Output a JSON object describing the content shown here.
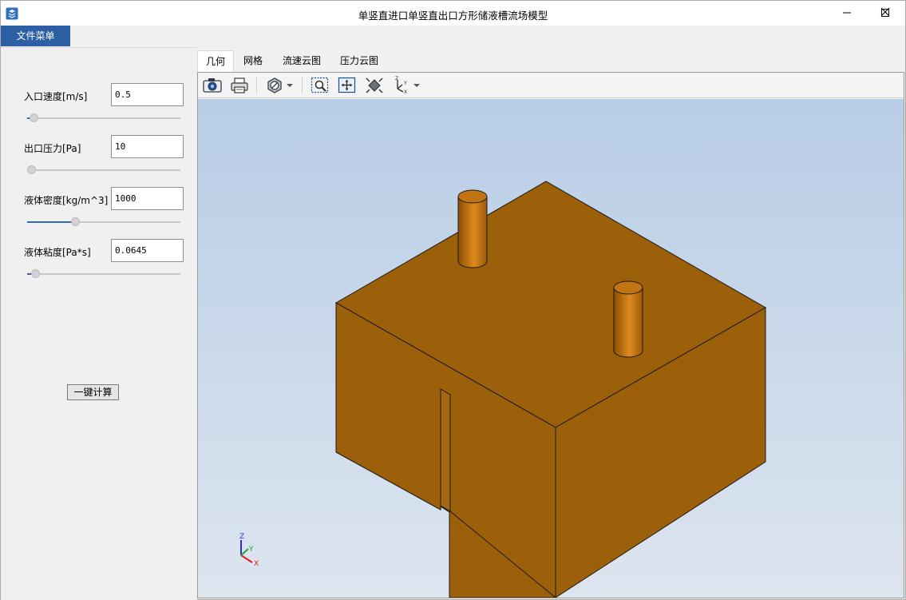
{
  "window": {
    "title": "单竖直进口单竖直出口方形储液槽流场模型",
    "app_icon": "app-logo-icon"
  },
  "menu": {
    "file_label": "文件菜单"
  },
  "params": [
    {
      "label": "入口速度[m/s]",
      "value": "0.5",
      "slider_level": 0.04
    },
    {
      "label": "出口压力[Pa]",
      "value": "10",
      "slider_level": 0.0
    },
    {
      "label": "液体密度[kg/m^3]",
      "value": "1000",
      "slider_level": 0.31
    },
    {
      "label": "液体粘度[Pa*s]",
      "value": "0.0645",
      "slider_level": 0.05
    }
  ],
  "calc_button": "一键计算",
  "tabs": [
    {
      "label": "几何",
      "active": true
    },
    {
      "label": "网格",
      "active": false
    },
    {
      "label": "流速云图",
      "active": false
    },
    {
      "label": "压力云图",
      "active": false
    }
  ],
  "toolbar": [
    "camera-icon",
    "print-icon",
    "display-mode-icon",
    "dropdown-arrow-icon",
    "zoom-window-icon",
    "pan-icon",
    "fit-all-icon",
    "view-orientation-icon",
    "dropdown-arrow-icon"
  ],
  "axes_triad": {
    "z": "Z",
    "y": "Y",
    "x": "X"
  },
  "colors": {
    "menu_accent": "#2c5fa3",
    "model_color": "#9c5f0a",
    "background_top": "#b8cde6",
    "background_bottom": "#dde5ef"
  }
}
